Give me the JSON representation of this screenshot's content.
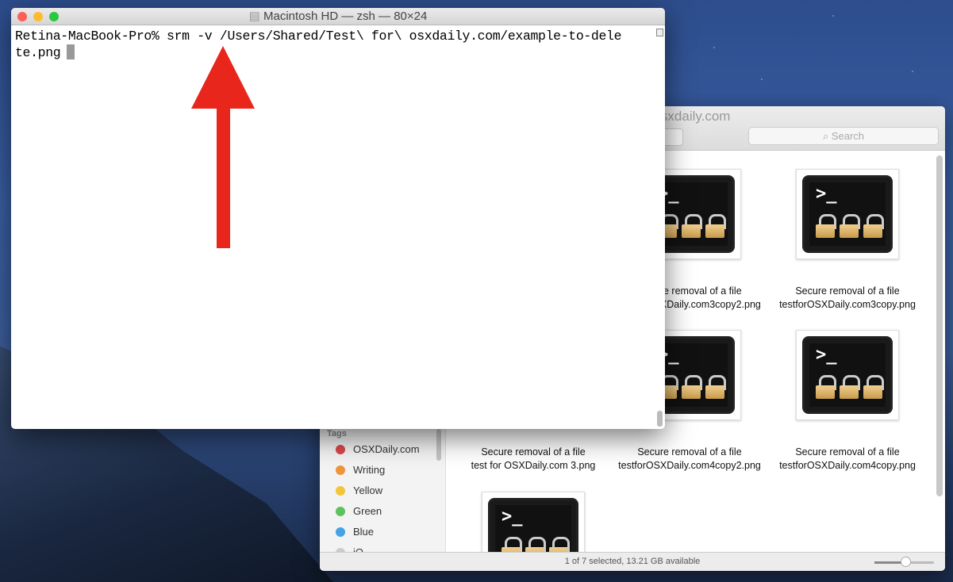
{
  "finder": {
    "title": "Test for osxdaily.com",
    "search_placeholder": "Search",
    "sidebar": {
      "tags_header": "Tags",
      "tags": [
        {
          "label": "OSXDaily.com",
          "color": "#d9474b"
        },
        {
          "label": "Writing",
          "color": "#f0943c"
        },
        {
          "label": "Yellow",
          "color": "#f2c53d"
        },
        {
          "label": "Green",
          "color": "#5cc25a"
        },
        {
          "label": "Blue",
          "color": "#45a3e6"
        },
        {
          "label": "iO",
          "color": "#cccccc"
        }
      ]
    },
    "files": [
      {
        "line1": "Secure removal of a file",
        "line2": "testforOSXDaily.com3copy2.png"
      },
      {
        "line1": "Secure removal of a file",
        "line2": "testforOSXDaily.com3copy.png"
      },
      {
        "line1": "Secure removal of a file",
        "line2": "test for OSXDaily.com 3.png"
      },
      {
        "line1": "Secure removal of a file",
        "line2": "testforOSXDaily.com4copy2.png"
      },
      {
        "line1": "Secure removal of a file",
        "line2": "testforOSXDaily.com4copy.png"
      },
      {
        "line1": "",
        "line2": ""
      }
    ],
    "icon_prompt": ">_",
    "status": "1 of 7 selected, 13.21 GB available",
    "icon_size_slider": 0.5
  },
  "terminal": {
    "title": "Macintosh HD — zsh — 80×24",
    "line1": "Retina-MacBook-Pro% srm -v /Users/Shared/Test\\ for\\ osxdaily.com/example-to-dele",
    "line2": "te.png",
    "arrow_color": "#e8261c"
  }
}
